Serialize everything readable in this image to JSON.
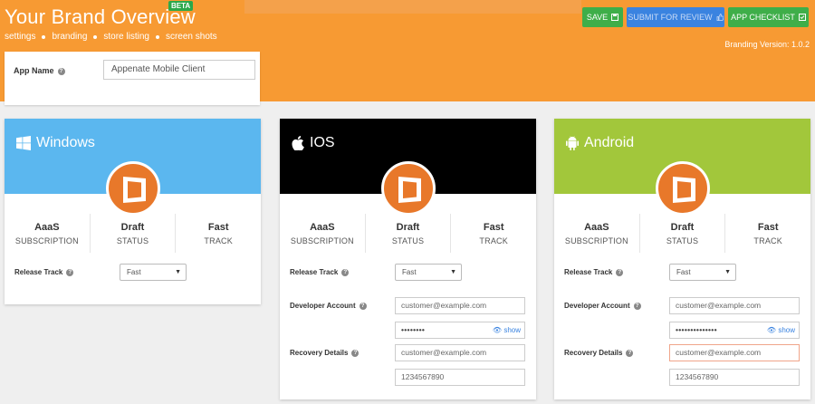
{
  "header": {
    "title": "Your Brand Overview",
    "badge": "BETA",
    "subnav": [
      "settings",
      "branding",
      "store listing",
      "screen shots"
    ],
    "branding_version": "Branding Version: 1.0.2",
    "buttons": {
      "save": "SAVE",
      "submit": "SUBMIT FOR REVIEW",
      "checklist": "APP CHECKLIST"
    }
  },
  "app_name": {
    "label": "App Name",
    "value": "Appenate Mobile Client"
  },
  "colors": {
    "windows": "#5bb7ef",
    "ios": "#000000",
    "android": "#a2c73b",
    "header": "#f79a33"
  },
  "cards": {
    "windows": {
      "title": "Windows",
      "icon": "windows-logo-icon",
      "stats": [
        {
          "value": "AaaS",
          "key": "SUBSCRIPTION"
        },
        {
          "value": "Draft",
          "key": "STATUS"
        },
        {
          "value": "Fast",
          "key": "TRACK"
        }
      ],
      "release_track_label": "Release Track",
      "release_track_value": "Fast"
    },
    "ios": {
      "title": "IOS",
      "icon": "apple-logo-icon",
      "stats": [
        {
          "value": "AaaS",
          "key": "SUBSCRIPTION"
        },
        {
          "value": "Draft",
          "key": "STATUS"
        },
        {
          "value": "Fast",
          "key": "TRACK"
        }
      ],
      "release_track_label": "Release Track",
      "release_track_value": "Fast",
      "developer_account_label": "Developer Account",
      "developer_email_placeholder": "customer@example.com",
      "developer_password_mask": "••••••••",
      "show_label": "show",
      "recovery_label": "Recovery Details",
      "recovery_email_placeholder": "customer@example.com",
      "recovery_phone_value": "1234567890"
    },
    "android": {
      "title": "Android",
      "icon": "android-logo-icon",
      "stats": [
        {
          "value": "AaaS",
          "key": "SUBSCRIPTION"
        },
        {
          "value": "Draft",
          "key": "STATUS"
        },
        {
          "value": "Fast",
          "key": "TRACK"
        }
      ],
      "release_track_label": "Release Track",
      "release_track_value": "Fast",
      "developer_account_label": "Developer Account",
      "developer_email_placeholder": "customer@example.com",
      "developer_password_mask": "••••••••••••••",
      "show_label": "show",
      "recovery_label": "Recovery Details",
      "recovery_email_placeholder": "customer@example.com",
      "recovery_phone_value": "1234567890"
    }
  }
}
